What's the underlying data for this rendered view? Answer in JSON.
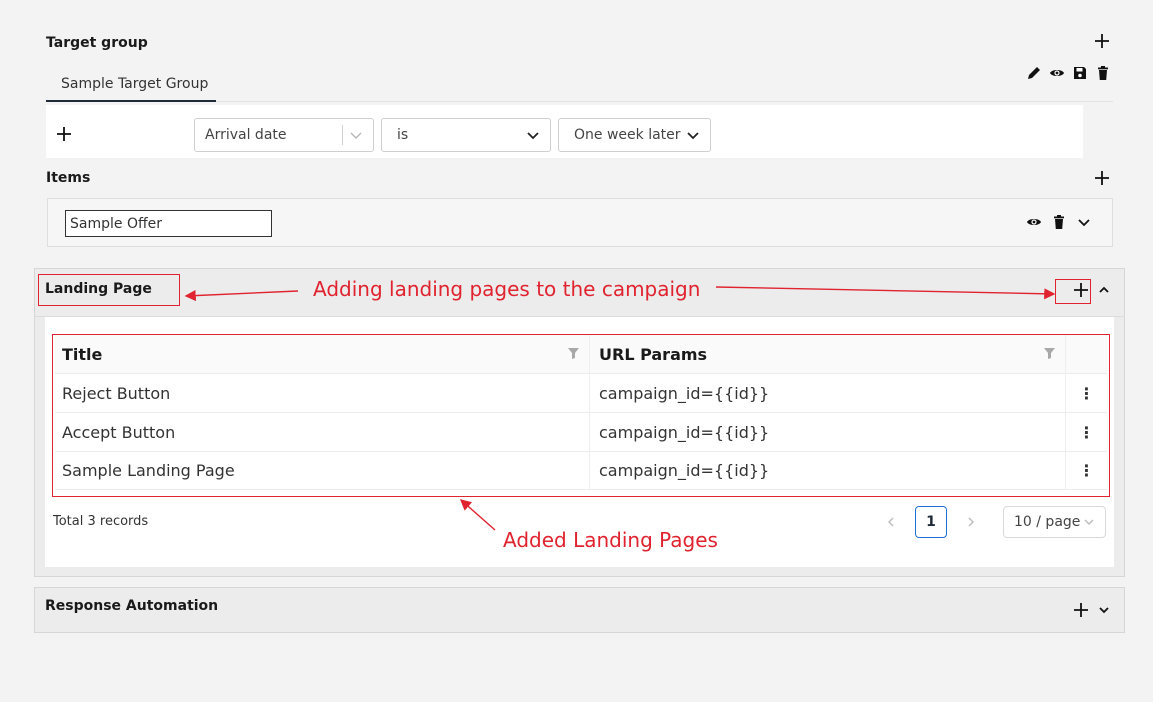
{
  "target_group": {
    "title": "Target group",
    "tab_label": "Sample Target Group",
    "rule": {
      "field": "Arrival date",
      "operator": "is",
      "value": "One week later"
    }
  },
  "items": {
    "title": "Items",
    "offer_value": "Sample Offer"
  },
  "landing_page": {
    "title": "Landing Page",
    "columns": [
      "Title",
      "URL Params"
    ],
    "rows": [
      {
        "title": "Reject Button",
        "params": "campaign_id={{id}}"
      },
      {
        "title": "Accept Button",
        "params": "campaign_id={{id}}"
      },
      {
        "title": "Sample Landing Page",
        "params": "campaign_id={{id}}"
      }
    ],
    "total": "Total 3 records",
    "current_page": "1",
    "page_size": "10 / page"
  },
  "response_automation": {
    "title": "Response Automation"
  },
  "annotations": {
    "adding": "Adding landing pages to the campaign",
    "added": "Added Landing Pages"
  },
  "colors": {
    "annotation": "#e0232e",
    "accent": "#1f6fd6",
    "background": "#f3f3f3"
  }
}
